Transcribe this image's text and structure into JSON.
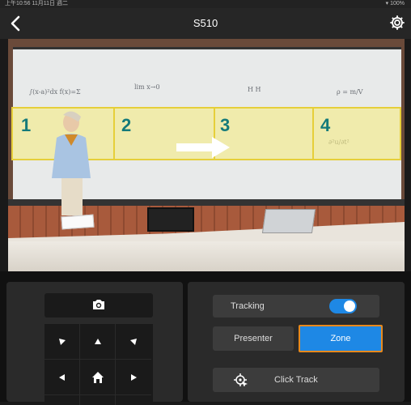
{
  "status_bar": {
    "left": "上午10:56  11月11日 週二",
    "right": "▾ 100%"
  },
  "header": {
    "title": "S510"
  },
  "video": {
    "zones": [
      "1",
      "2",
      "3",
      "4"
    ]
  },
  "controls": {
    "tracking_label": "Tracking",
    "tracking_on": true,
    "presenter_label": "Presenter",
    "zone_label": "Zone",
    "click_track_label": "Click Track"
  },
  "colors": {
    "accent": "#1e88e5",
    "selected_outline": "#e8891c",
    "zone_fill": "#f5eb82",
    "zone_number": "#147a7a"
  }
}
